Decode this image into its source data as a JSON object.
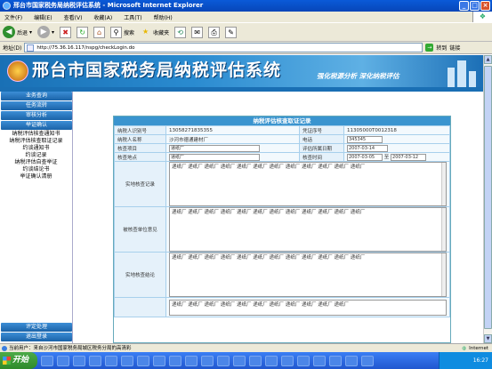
{
  "window": {
    "title": "邢台市国家税务局纳税评估系统 - Microsoft Internet Explorer"
  },
  "menu": [
    "文件(F)",
    "编辑(E)",
    "查看(V)",
    "收藏(A)",
    "工具(T)",
    "帮助(H)"
  ],
  "toolbar": {
    "back": "后退",
    "search": "搜索",
    "favorites": "收藏夹"
  },
  "address": {
    "label": "地址(D)",
    "url": "http://75.36.16.117/nspg/checkLogin.do",
    "go": "转到",
    "links": "链接"
  },
  "banner": {
    "title": "邢台市国家税务局纳税评估系统",
    "slogan": "强化税源分析   深化纳税评估"
  },
  "sidebar": {
    "top_buttons": [
      "业务查询",
      "任务流转",
      "审核分析",
      "举证确认"
    ],
    "items": [
      "纳税评估核查通知书",
      "纳税评估核查取证记录",
      "约谈通知书",
      "约谈记录",
      "纳税评估自查举证",
      "约谈结论书",
      "举证确认清册"
    ],
    "bottom_buttons": [
      "评定处理",
      "退出登录"
    ]
  },
  "form": {
    "title": "纳税评估核查取证记录",
    "taxpayer_id_label": "纳税人识别号",
    "taxpayer_id": "13058271835355",
    "voucher_no_label": "凭证序号",
    "voucher_no": "11305000T0012318",
    "taxpayer_name_label": "纳税人名称",
    "taxpayer_name": "沙河市德通建材厂",
    "phone_label": "电话",
    "phone": "345345",
    "check_item_label": "核查项目",
    "check_item": "递纸厂",
    "eval_date_label": "评估所属日期",
    "eval_date": "2007-03-14",
    "check_place_label": "核查地点",
    "check_place": "递纸厂",
    "check_time_label": "核查时间",
    "check_time_from": "2007-03-05",
    "check_time_sep": "至",
    "check_time_to": "2007-03-12",
    "onsite_record_label": "实地核查记录",
    "onsite_record_text": "递纸厂  递纸厂  递纸厂  递纸厂  递纸厂  递纸厂  递纸厂  递纸厂  递纸厂  递纸厂  递纸厂  递纸厂",
    "opinion_label": "被核查单位意见",
    "opinion_text": "递纸厂  递纸厂  递纸厂  递纸厂  递纸厂  递纸厂  递纸厂  递纸厂  递纸厂  递纸厂  递纸厂  递纸厂",
    "conclusion_label": "实地核查结论",
    "conclusion_text": "递纸厂  递纸厂  递纸厂  递纸厂  递纸厂  递纸厂  递纸厂  递纸厂  递纸厂  递纸厂  递纸厂  递纸厂",
    "extra_text": "递纸厂  递纸厂  递纸厂  递纸厂  递纸厂  递纸厂  递纸厂  递纸厂  递纸厂  递纸厂  递纸厂"
  },
  "status": {
    "text": "当前用户：来自沙河市国家税务局城区税务分局的高清彩",
    "zone": "Internet"
  },
  "taskbar": {
    "start": "开始",
    "clock": "16:27"
  }
}
